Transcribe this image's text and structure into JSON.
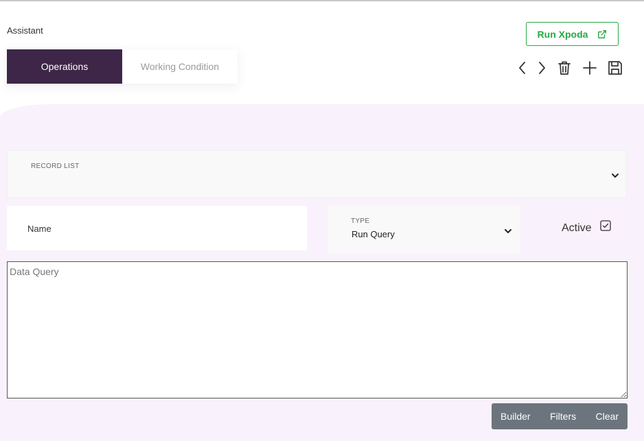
{
  "breadcrumb": "Assistant",
  "tabs": [
    {
      "label": "Operations",
      "active": true
    },
    {
      "label": "Working Condition",
      "active": false
    }
  ],
  "header": {
    "run_button_label": "Run Xpoda",
    "run_button_icon": "external-link-icon"
  },
  "toolbar": {
    "icons": [
      "chevron-left-icon",
      "chevron-right-icon",
      "trash-icon",
      "plus-icon",
      "save-icon"
    ]
  },
  "record_list": {
    "label": "RECORD LIST",
    "value": ""
  },
  "form": {
    "name_placeholder": "Name",
    "type_label": "TYPE",
    "type_value": "Run Query",
    "active_label": "Active",
    "active_checked": true,
    "query_placeholder": "Data Query"
  },
  "actions": {
    "builder": "Builder",
    "filters": "Filters",
    "clear": "Clear"
  },
  "colors": {
    "accent": "#3d2648",
    "success": "#28a745",
    "panel_bg": "#f9f1fb",
    "button_group": "#6c757d"
  }
}
